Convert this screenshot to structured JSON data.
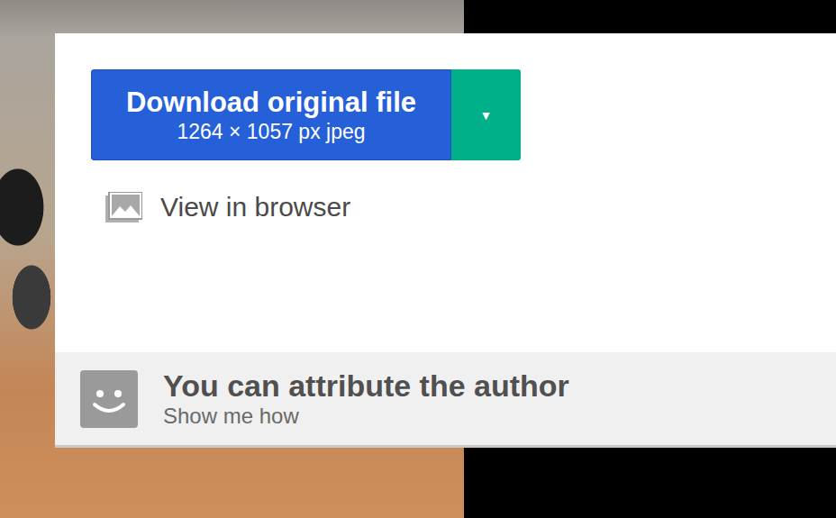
{
  "download": {
    "label": "Download original file",
    "details": "1264 × 1057 px jpeg",
    "dropdown_icon": "▼"
  },
  "view_in_browser": {
    "label": "View in browser"
  },
  "attribution": {
    "title": "You can attribute the author",
    "link": "Show me how"
  }
}
